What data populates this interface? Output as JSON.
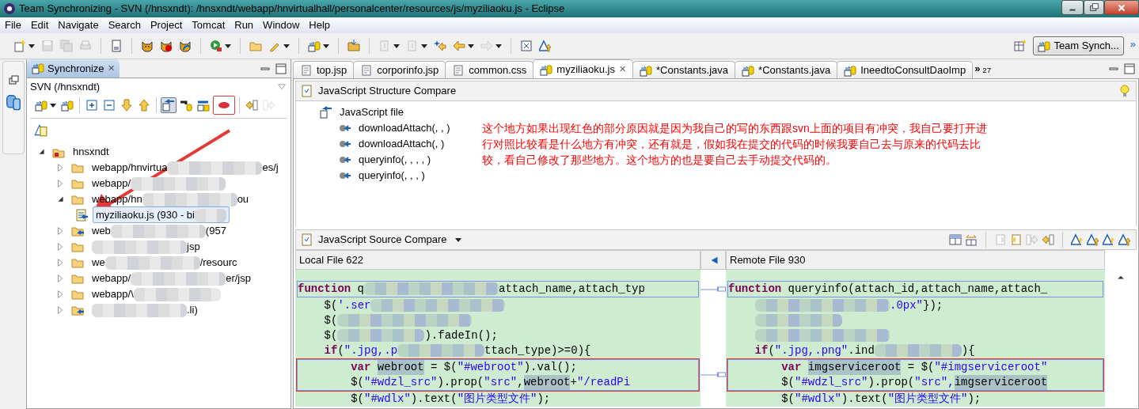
{
  "window": {
    "title": "Team Synchronizing - SVN (/hnsxndt): /hnsxndt/webapp/hnvirtualhall/personalcenter/resources/js/myziliaoku.js - Eclipse"
  },
  "menu": [
    "File",
    "Edit",
    "Navigate",
    "Search",
    "Project",
    "Tomcat",
    "Run",
    "Window",
    "Help"
  ],
  "main_toolbar": [
    {
      "disabled": false
    },
    {
      "disabled": true
    },
    {
      "disabled": true
    },
    {
      "disabled": true
    },
    {
      "disabled": false
    },
    {
      "disabled": false
    },
    {
      "disabled": false
    },
    {
      "disabled": false
    },
    {
      "disabled": false
    },
    {
      "disabled": false
    },
    {
      "disabled": false
    },
    {
      "disabled": false
    },
    {
      "disabled": false
    },
    {
      "disabled": true
    },
    {
      "disabled": true
    },
    {
      "disabled": false
    },
    {
      "disabled": false
    },
    {
      "disabled": true
    },
    {
      "disabled": false
    },
    {
      "disabled": false
    }
  ],
  "perspective": {
    "label": "Team Synch...",
    "selected": true,
    "overflow": "»"
  },
  "sync_view": {
    "title": "Synchronize",
    "close": "✕",
    "subtitle": "SVN (/hnsxndt)",
    "toolbar": [
      {
        "selected": false,
        "marked": false
      },
      {
        "selected": false,
        "marked": false
      },
      {
        "selected": false,
        "marked": false
      },
      {
        "selected": false,
        "marked": false
      },
      {
        "selected": false,
        "marked": false
      },
      {
        "selected": false,
        "marked": false
      },
      {
        "selected": true,
        "marked": false
      },
      {
        "selected": false,
        "marked": false
      },
      {
        "selected": false,
        "marked": false
      },
      {
        "selected": false,
        "marked": true
      },
      {
        "selected": false,
        "marked": false
      },
      {
        "selected": false,
        "marked": false
      }
    ],
    "tree": [
      {
        "kind": "project",
        "parts": [
          {
            "kind": "plain",
            "text": "hnsxndt"
          }
        ],
        "expanded": true,
        "selected": false,
        "incoming": false,
        "children": [
          {
            "kind": "folder",
            "parts": [
              {
                "kind": "plain",
                "text": "webapp/hnvirtua"
              },
              {
                "kind": "blur-l"
              },
              {
                "kind": "plain",
                "text": "es/j"
              }
            ],
            "expanded": false,
            "selected": false,
            "incoming": false
          },
          {
            "kind": "folder",
            "parts": [
              {
                "kind": "plain",
                "text": "webapp/"
              },
              {
                "kind": "blur-l"
              }
            ],
            "expanded": false,
            "selected": false,
            "incoming": false
          },
          {
            "kind": "folder",
            "parts": [
              {
                "kind": "plain",
                "text": "webapp/hn"
              },
              {
                "kind": "blur-l"
              },
              {
                "kind": "plain",
                "text": "ou"
              }
            ],
            "expanded": true,
            "selected": false,
            "incoming": false,
            "children": [
              {
                "kind": "file",
                "parts": [
                  {
                    "kind": "plain",
                    "text": "myziliaoku.js (930 - bi"
                  },
                  {
                    "kind": "blur-s"
                  }
                ],
                "selected": true,
                "incoming": true
              }
            ]
          },
          {
            "kind": "folder",
            "parts": [
              {
                "kind": "plain",
                "text": "web"
              },
              {
                "kind": "blur-l"
              },
              {
                "kind": "plain",
                "text": "(957"
              }
            ],
            "expanded": false,
            "selected": false,
            "incoming": true
          },
          {
            "kind": "folder",
            "parts": [
              {
                "kind": "blur-l"
              },
              {
                "kind": "plain",
                "text": "jsp"
              }
            ],
            "expanded": false,
            "selected": false,
            "incoming": false
          },
          {
            "kind": "folder",
            "parts": [
              {
                "kind": "plain",
                "text": "we"
              },
              {
                "kind": "blur-l"
              },
              {
                "kind": "plain",
                "text": "/resourc"
              }
            ],
            "expanded": false,
            "selected": false,
            "incoming": false
          },
          {
            "kind": "folder",
            "parts": [
              {
                "kind": "plain",
                "text": "webapp/"
              },
              {
                "kind": "blur-l"
              },
              {
                "kind": "plain",
                "text": "er/jsp"
              }
            ],
            "expanded": false,
            "selected": false,
            "incoming": false
          },
          {
            "kind": "folder",
            "parts": [
              {
                "kind": "plain",
                "text": "webapp/\\"
              },
              {
                "kind": "blur-m"
              }
            ],
            "expanded": false,
            "selected": false,
            "incoming": false
          },
          {
            "kind": "folder",
            "parts": [
              {
                "kind": "blur-l"
              },
              {
                "kind": "plain",
                "text": ".li)"
              }
            ],
            "expanded": false,
            "selected": false,
            "incoming": true
          }
        ]
      }
    ]
  },
  "tabs": [
    {
      "label": "top.jsp",
      "kind": "file",
      "selected": false
    },
    {
      "label": "corporinfo.jsp",
      "kind": "file",
      "selected": false
    },
    {
      "label": "common.css",
      "kind": "file",
      "selected": false
    },
    {
      "label": "myziliaoku.js",
      "kind": "compare",
      "selected": true,
      "close": "✕"
    },
    {
      "label": "*Constants.java",
      "kind": "compare",
      "selected": false
    },
    {
      "label": "*Constants.java",
      "kind": "compare",
      "selected": false
    },
    {
      "label": "IneedtoConsultDaoImp",
      "kind": "compare",
      "selected": false
    }
  ],
  "tab_overflow": {
    "symbol": "»",
    "count": "27"
  },
  "structure_compare": {
    "title": "JavaScript Structure Compare",
    "root": "JavaScript file",
    "members": [
      "downloadAttach(, , )",
      "downloadAttach(, )",
      "queryinfo(, , , , )",
      "queryinfo(, , , )"
    ],
    "note": "这个地方如果出现红色的部分原因就是因为我自己的写的东西跟svn上面的项目有冲突，我自己要打开进行对照比较看是什么地方有冲突，还有就是，假如我在提交的代码的时候我要自己去与原来的代码去比较，看自己修改了那些地方。这个地方的也是要自己去手动提交代码的。"
  },
  "source_compare": {
    "title": "JavaScript Source Compare",
    "left_header": "Local File 622",
    "right_header": "Remote File 930",
    "hunks": [
      {
        "changed": true,
        "marked": false,
        "local": [
          [
            {
              "kind": "keyword",
              "text": "function"
            },
            {
              "kind": "plain",
              "text": " q"
            },
            {
              "kind": "blur-l"
            },
            {
              "kind": "plain",
              "text": "attach_name,attach_typ"
            }
          ]
        ],
        "remote": [
          [
            {
              "kind": "keyword",
              "text": "function"
            },
            {
              "kind": "plain",
              "text": " queryinfo(attach_id,attach_name,attach_"
            }
          ]
        ]
      },
      {
        "changed": false,
        "marked": false,
        "local": [
          [
            {
              "kind": "plain",
              "text": "    $("
            },
            {
              "kind": "string",
              "text": "'.ser"
            },
            {
              "kind": "blur-l"
            }
          ],
          [
            {
              "kind": "plain",
              "text": "    $("
            },
            {
              "kind": "blur-l"
            }
          ],
          [
            {
              "kind": "plain",
              "text": "    $("
            },
            {
              "kind": "blur-m"
            },
            {
              "kind": "plain",
              "text": ").fadeIn();"
            }
          ],
          [
            {
              "kind": "keyword",
              "text": "    if"
            },
            {
              "kind": "plain",
              "text": "("
            },
            {
              "kind": "string",
              "text": "\".jpg,.p"
            },
            {
              "kind": "blur-m"
            },
            {
              "kind": "plain",
              "text": "ttach_type)>=0){"
            }
          ]
        ],
        "remote": [
          [
            {
              "kind": "blur-l"
            },
            {
              "kind": "string",
              "text": ".0px\""
            },
            {
              "kind": "plain",
              "text": "});"
            }
          ],
          [
            {
              "kind": "blur-m"
            }
          ],
          [
            {
              "kind": "blur-l"
            }
          ],
          [
            {
              "kind": "keyword",
              "text": "    if"
            },
            {
              "kind": "plain",
              "text": "("
            },
            {
              "kind": "string",
              "text": "\".jpg,.png\""
            },
            {
              "kind": "plain",
              "text": ".ind"
            },
            {
              "kind": "blur-m"
            },
            {
              "kind": "plain",
              "text": "){"
            }
          ]
        ]
      },
      {
        "changed": true,
        "marked": true,
        "local": [
          [
            {
              "kind": "keyword",
              "text": "        var "
            },
            {
              "kind": "highlight",
              "text": "webroot"
            },
            {
              "kind": "plain",
              "text": " = $("
            },
            {
              "kind": "string",
              "text": "\"#webroot\""
            },
            {
              "kind": "plain",
              "text": ").val();"
            }
          ],
          [
            {
              "kind": "plain",
              "text": "        $("
            },
            {
              "kind": "string",
              "text": "\"#wdzl_src\""
            },
            {
              "kind": "plain",
              "text": ").prop("
            },
            {
              "kind": "string",
              "text": "\"src\""
            },
            {
              "kind": "plain",
              "text": ","
            },
            {
              "kind": "highlight",
              "text": "webroot"
            },
            {
              "kind": "plain",
              "text": "+"
            },
            {
              "kind": "string",
              "text": "\"/readPi"
            }
          ]
        ],
        "remote": [
          [
            {
              "kind": "keyword",
              "text": "        var "
            },
            {
              "kind": "highlight",
              "text": "imgserviceroot"
            },
            {
              "kind": "plain",
              "text": " = $("
            },
            {
              "kind": "string",
              "text": "\"#imgserviceroot\""
            }
          ],
          [
            {
              "kind": "plain",
              "text": "        $("
            },
            {
              "kind": "string",
              "text": "\"#wdzl_src\""
            },
            {
              "kind": "plain",
              "text": ").prop("
            },
            {
              "kind": "string",
              "text": "\"src\","
            },
            {
              "kind": "highlight",
              "text": "imgserviceroot"
            }
          ]
        ]
      },
      {
        "changed": false,
        "marked": false,
        "local": [
          [
            {
              "kind": "plain",
              "text": "        $("
            },
            {
              "kind": "string",
              "text": "\"#wdlx\""
            },
            {
              "kind": "plain",
              "text": ").text("
            },
            {
              "kind": "string",
              "text": "\"图片类型文件\""
            },
            {
              "kind": "plain",
              "text": ");"
            }
          ]
        ],
        "remote": [
          [
            {
              "kind": "plain",
              "text": "        $("
            },
            {
              "kind": "string",
              "text": "\"#wdlx\""
            },
            {
              "kind": "plain",
              "text": ").text("
            },
            {
              "kind": "string",
              "text": "\"图片类型文件\""
            },
            {
              "kind": "plain",
              "text": ");"
            }
          ]
        ]
      }
    ]
  }
}
